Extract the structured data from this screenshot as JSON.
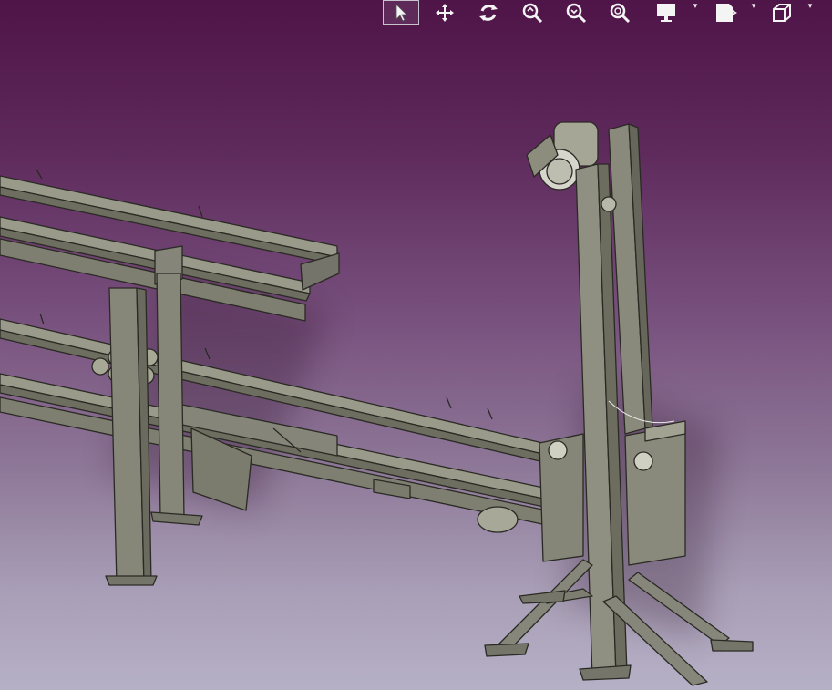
{
  "app": {
    "viewport": {
      "background": {
        "top": "#4f1448",
        "bottom": "#b6b0c6"
      },
      "model_color": "#8c8c7c"
    },
    "toolbar": {
      "tools": [
        {
          "icon": "select-arrow-icon",
          "active": true
        },
        {
          "icon": "pan-icon",
          "active": false
        },
        {
          "icon": "rotate-icon",
          "active": false
        },
        {
          "icon": "zoom-in-icon",
          "active": false
        },
        {
          "icon": "zoom-out-icon",
          "active": false
        },
        {
          "icon": "fit-all-icon",
          "active": false
        },
        {
          "icon": "display-mode-icon",
          "active": false,
          "has_menu": true
        },
        {
          "icon": "render-style-icon",
          "active": false,
          "has_menu": true
        },
        {
          "icon": "view-cube-icon",
          "active": false,
          "has_menu": true
        }
      ]
    }
  }
}
